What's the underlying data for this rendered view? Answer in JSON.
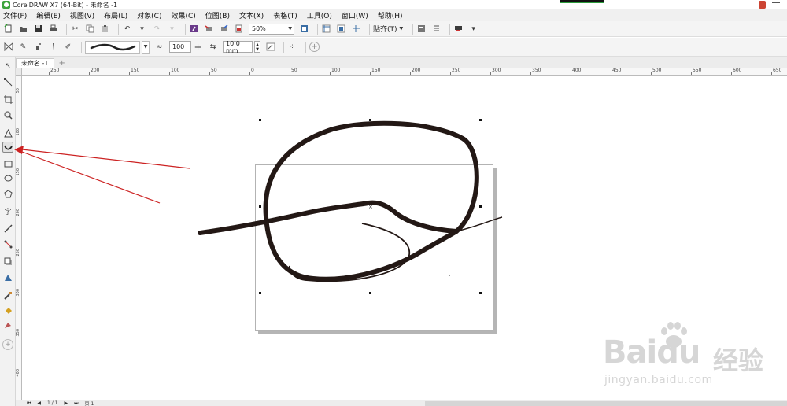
{
  "window": {
    "title": "CorelDRAW X7 (64-Bit) - 未命名 -1"
  },
  "menu": [
    "文件(F)",
    "编辑(E)",
    "视图(V)",
    "布局(L)",
    "对象(C)",
    "效果(C)",
    "位图(B)",
    "文本(X)",
    "表格(T)",
    "工具(O)",
    "窗口(W)",
    "帮助(H)"
  ],
  "toolbar": {
    "zoom_value": "50%",
    "snap_label": "贴齐(T)"
  },
  "property_bar": {
    "smoothing_value": "100",
    "stroke_width_value": "10.0 mm"
  },
  "document_tab": {
    "label": "未命名 -1"
  },
  "rulers": {
    "h_labels": [
      "250",
      "200",
      "150",
      "100",
      "50",
      "0",
      "50",
      "100",
      "150",
      "200",
      "250",
      "300",
      "350",
      "400",
      "450",
      "500",
      "550",
      "600",
      "650"
    ],
    "v_labels": [
      "50",
      "100",
      "150",
      "200",
      "250",
      "300",
      "350",
      "400"
    ]
  },
  "page_nav": {
    "page_count": "1 / 1",
    "page_tab": "页 1"
  },
  "watermark": {
    "main": "Baidu",
    "cn": "经验",
    "sub": "jingyan.baidu.com"
  },
  "icons": {
    "toolbox": [
      "pick-tool-icon",
      "shape-tool-icon",
      "crop-tool-icon",
      "zoom-tool-icon",
      "smart-fill-icon",
      "artistic-media-icon",
      "rectangle-tool-icon",
      "ellipse-tool-icon",
      "polygon-tool-icon",
      "text-tool-icon",
      "parallel-dimension-icon",
      "connector-tool-icon",
      "drop-shadow-icon",
      "transparency-icon",
      "eyedropper-icon",
      "interactive-fill-icon",
      "smart-fill-tool-icon",
      "add-tool-icon"
    ]
  },
  "colors": {
    "annotation_arrow": "#cc2222",
    "stroke": "#231815"
  }
}
